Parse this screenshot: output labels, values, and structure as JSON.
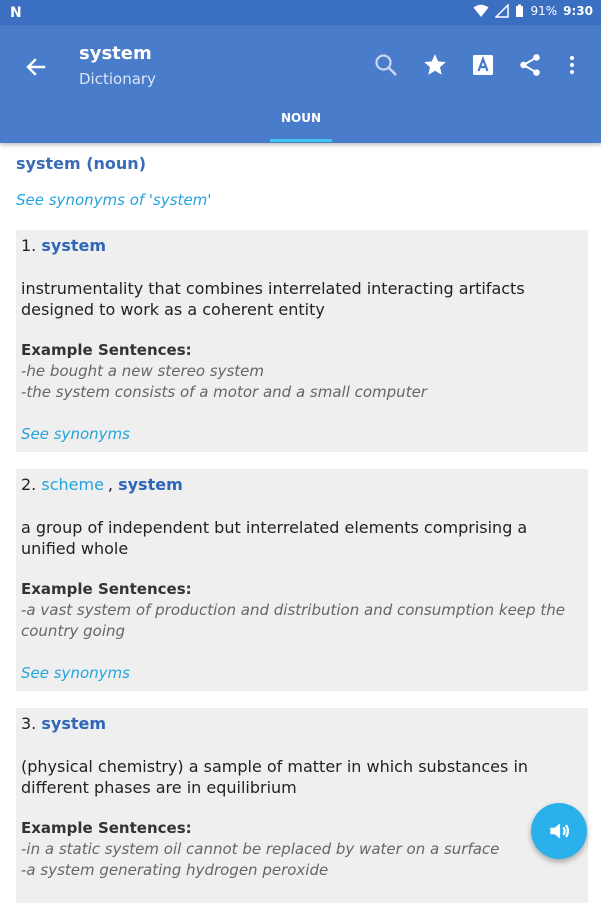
{
  "status": {
    "battery": "91%",
    "time": "9:30"
  },
  "appbar": {
    "title": "system",
    "subtitle": "Dictionary"
  },
  "tabs": [
    {
      "label": "NOUN",
      "active": true
    }
  ],
  "heading": "system (noun)",
  "see_synonyms_all": "See synonyms of 'system'",
  "entries": [
    {
      "number": "1.",
      "terms": [
        {
          "text": "system"
        }
      ],
      "definition": "instrumentality that combines interrelated interacting artifacts designed to work as a coherent entity",
      "examples_label": "Example Sentences:",
      "examples": [
        "-he bought a new stereo system",
        "-the system consists of a motor and a small computer"
      ],
      "see_synonyms": "See synonyms"
    },
    {
      "number": "2.",
      "terms": [
        {
          "text": "scheme"
        },
        {
          "separator": ","
        },
        {
          "text": "system"
        }
      ],
      "definition": "a group of independent but interrelated elements comprising a unified whole",
      "examples_label": "Example Sentences:",
      "examples": [
        "-a vast system of production and distribution and consumption keep the country going"
      ],
      "see_synonyms": "See synonyms"
    },
    {
      "number": "3.",
      "terms": [
        {
          "text": "system"
        }
      ],
      "definition": "(physical chemistry) a sample of matter in which substances in different phases are in equilibrium",
      "examples_label": "Example Sentences:",
      "examples": [
        "-in a static system oil cannot be replaced by water on a surface",
        "-a system generating hydrogen peroxide"
      ]
    }
  ],
  "colors": {
    "appbar": "#4a7ccc",
    "status_bar": "#3b6fc2",
    "accent": "#23a4dd",
    "fab": "#2ab0ea",
    "card": "#efefef"
  },
  "icons": [
    "back-arrow-icon",
    "search-icon",
    "star-icon",
    "font-icon",
    "share-icon",
    "more-vert-icon",
    "speaker-icon"
  ]
}
